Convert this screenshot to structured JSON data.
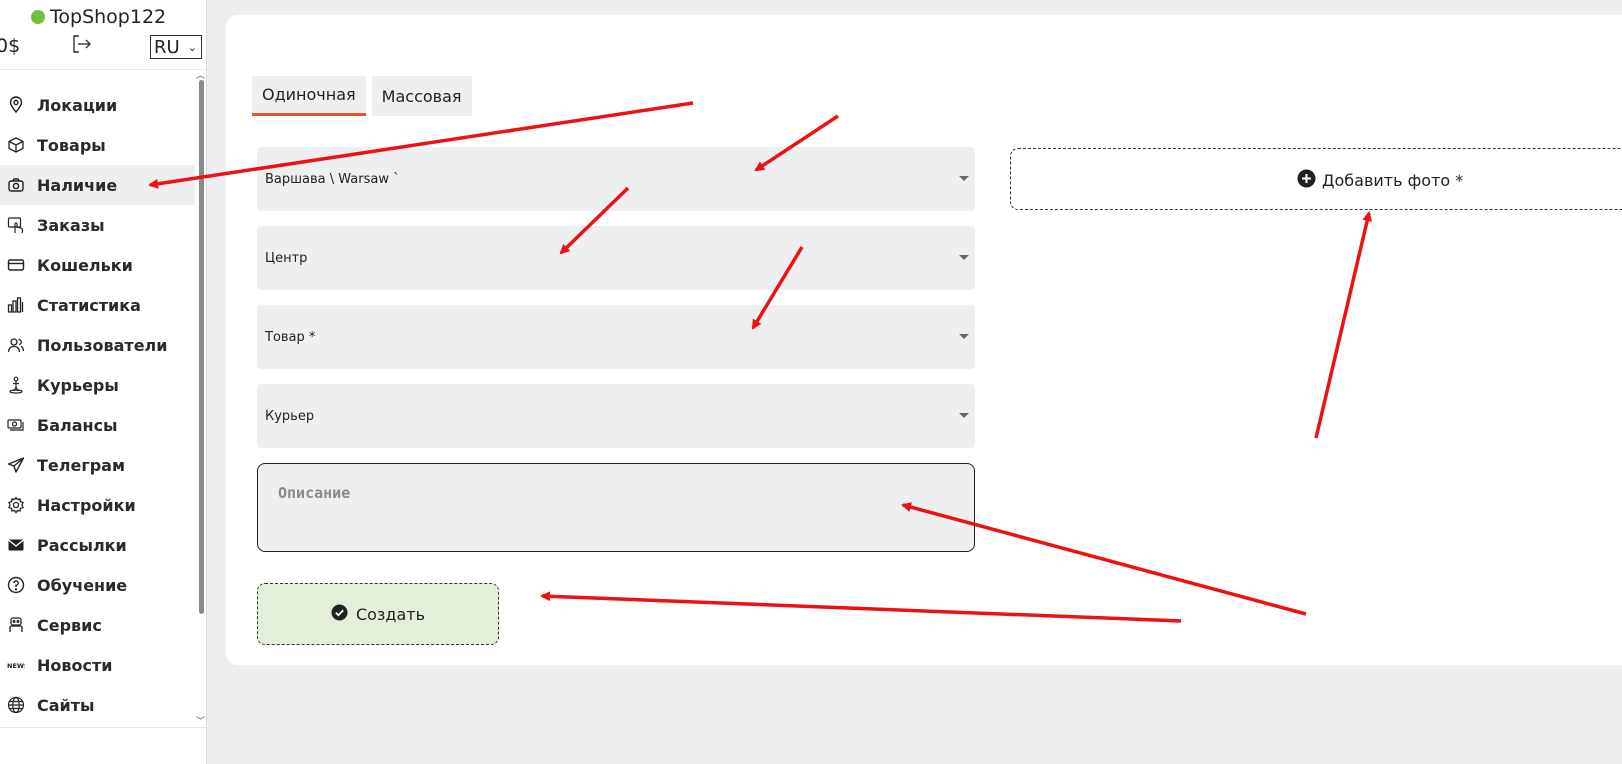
{
  "colors": {
    "status": "#6fc13a",
    "accent": "#e8552c",
    "annotation": "#ee1111",
    "create_bg": "#e3efd9"
  },
  "header": {
    "shop_name": "TopShop122",
    "balance": "0$",
    "language": "RU"
  },
  "sidebar": {
    "items": [
      {
        "label": "Локации",
        "icon": "location-pin-icon"
      },
      {
        "label": "Товары",
        "icon": "box-icon"
      },
      {
        "label": "Наличие",
        "icon": "camera-icon"
      },
      {
        "label": "Заказы",
        "icon": "hand-pointer-icon"
      },
      {
        "label": "Кошельки",
        "icon": "credit-card-icon"
      },
      {
        "label": "Статистика",
        "icon": "bar-chart-icon"
      },
      {
        "label": "Пользователи",
        "icon": "users-icon"
      },
      {
        "label": "Курьеры",
        "icon": "courier-icon"
      },
      {
        "label": "Балансы",
        "icon": "money-icon"
      },
      {
        "label": "Телеграм",
        "icon": "telegram-icon"
      },
      {
        "label": "Настройки",
        "icon": "gear-icon"
      },
      {
        "label": "Рассылки",
        "icon": "envelope-icon"
      },
      {
        "label": "Обучение",
        "icon": "question-icon"
      },
      {
        "label": "Сервис",
        "icon": "service-icon"
      },
      {
        "label": "Новости",
        "icon": "news-icon"
      },
      {
        "label": "Сайты",
        "icon": "globe-icon"
      }
    ],
    "active_item": "Наличие"
  },
  "main": {
    "tabs": [
      {
        "label": "Одиночная"
      },
      {
        "label": "Массовая"
      }
    ],
    "fields": {
      "city": "Варшава \\ Warsaw `",
      "district": "Центр",
      "product": "Товар *",
      "courier": "Курьер"
    },
    "description_placeholder": "Описание",
    "create_label": "Создать",
    "add_photo_label": "Добавить фото *"
  }
}
